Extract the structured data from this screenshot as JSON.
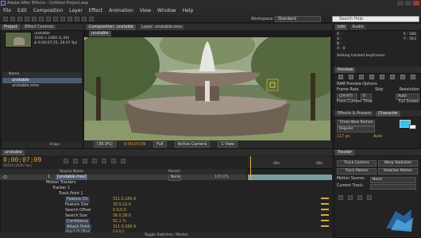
{
  "window": {
    "title": "Adobe After Effects - Untitled Project.aep"
  },
  "menu": [
    "File",
    "Edit",
    "Composition",
    "Layer",
    "Effect",
    "Animation",
    "View",
    "Window",
    "Help"
  ],
  "toolbar": {
    "workspace_label": "Workspace:",
    "workspace_value": "Standard",
    "search_placeholder": "Search Help"
  },
  "project": {
    "tabs": [
      "Project",
      "Effect Controls"
    ],
    "comp_name": "unstable",
    "info_line1": "1920 x 1080 (1.00)",
    "info_line2": "Δ 0;00;07;15, 29.97 fps",
    "column_name": "Name",
    "items": [
      "unstable",
      "unstable.mov"
    ],
    "footer_bpc": "8 bpc"
  },
  "viewer": {
    "tabs": [
      "Composition: unstable",
      "Layer: unstable.mov"
    ],
    "comp_button": "unstable",
    "zoom": "(39.9%)",
    "timecode": "0;00;07;09",
    "resolution": "Full",
    "camera": "Active Camera",
    "views": "1 View"
  },
  "info": {
    "tabs": [
      "Info",
      "Audio"
    ],
    "r": "R :",
    "g": "G :",
    "b": "B :",
    "a": "A : 0",
    "x": "X : 586",
    "y": "Y : 563",
    "status": "Setting tracked keyframes"
  },
  "preview": {
    "title": "Preview",
    "ram_options": "RAM Preview Options",
    "frame_rate_label": "Frame Rate",
    "skip_label": "Skip",
    "resolution_label": "Resolution",
    "frame_rate": "(29.97)",
    "skip": "0",
    "resolution": "Auto",
    "from_current": "From Current Time",
    "full_screen": "Full Screen"
  },
  "character": {
    "tabs": [
      "Effects & Presets",
      "Character"
    ],
    "font": "Times New Roman",
    "style": "Regular",
    "size": "117 px",
    "leading": "Auto"
  },
  "timeline": {
    "tabs": [
      "unstable"
    ],
    "timecode": "0;00;07;09",
    "fps": "00219 (29.97 fps)",
    "ruler": [
      "06s",
      "08s"
    ],
    "col_source": "Source Name",
    "col_mode": "Parent",
    "parent_value": "None",
    "layer_index": "1",
    "layer_name": "[unstable.mov]",
    "layer_stretch": "100.0%",
    "rows": [
      {
        "label": "Motion Trackers",
        "value": ""
      },
      {
        "label": "Tracker 1",
        "value": ""
      },
      {
        "label": "Track Point 1",
        "value": ""
      },
      {
        "label": "Feature Ctr",
        "value": "311.0,189.9"
      },
      {
        "label": "Feature Size",
        "value": "30.0,22.0"
      },
      {
        "label": "Search Offset",
        "value": "0.0,0.0"
      },
      {
        "label": "Search Size",
        "value": "36.0,28.0"
      },
      {
        "label": "Confidence",
        "value": "92.1 %"
      },
      {
        "label": "Attach Point",
        "value": "311.0,189.9"
      },
      {
        "label": "Attach Pt Offset",
        "value": "0.0,0.0"
      }
    ],
    "status": "Toggle Switches / Modes"
  },
  "tracker": {
    "title": "Tracker",
    "track_camera": "Track Camera",
    "warp_stabilizer": "Warp Stabilizer",
    "track_motion": "Track Motion",
    "stabilize_motion": "Stabilize Motion",
    "motion_source_label": "Motion Source:",
    "motion_source": "None",
    "current_track_label": "Current Track:"
  },
  "colors": {
    "accent": "#e8a030",
    "selection": "#4c5b70",
    "swatch": "#2ec4ee"
  }
}
